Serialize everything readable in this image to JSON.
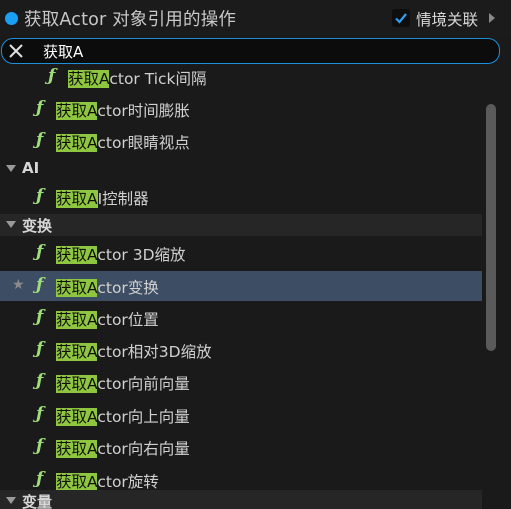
{
  "header": {
    "title": "获取Actor 对象引用的操作",
    "context_label": "情境关联",
    "context_checked": true,
    "accent": "#19a0f2"
  },
  "search": {
    "value": "获取A",
    "highlight_color": "#8fc640"
  },
  "rows": [
    {
      "kind": "item",
      "indent": 2,
      "match": "获取A",
      "rest": "ctor Tick间隔"
    },
    {
      "kind": "item",
      "indent": 1,
      "match": "获取A",
      "rest": "ctor时间膨胀"
    },
    {
      "kind": "item",
      "indent": 1,
      "match": "获取A",
      "rest": "ctor眼睛视点"
    },
    {
      "kind": "category",
      "label": "AI"
    },
    {
      "kind": "item",
      "indent": 1,
      "match": "获取A",
      "rest": "I控制器"
    },
    {
      "kind": "category",
      "label": "变换"
    },
    {
      "kind": "item",
      "indent": 1,
      "match": "获取A",
      "rest": "ctor 3D缩放"
    },
    {
      "kind": "item",
      "indent": 1,
      "match": "获取A",
      "rest": "ctor变换",
      "selected": true,
      "favorite": true
    },
    {
      "kind": "item",
      "indent": 1,
      "match": "获取A",
      "rest": "ctor位置"
    },
    {
      "kind": "item",
      "indent": 1,
      "match": "获取A",
      "rest": "ctor相对3D缩放"
    },
    {
      "kind": "item",
      "indent": 1,
      "match": "获取A",
      "rest": "ctor向前向量"
    },
    {
      "kind": "item",
      "indent": 1,
      "match": "获取A",
      "rest": "ctor向上向量"
    },
    {
      "kind": "item",
      "indent": 1,
      "match": "获取A",
      "rest": "ctor向右向量"
    },
    {
      "kind": "item",
      "indent": 1,
      "match": "获取A",
      "rest": "ctor旋转"
    },
    {
      "kind": "category",
      "label": "变量"
    }
  ]
}
